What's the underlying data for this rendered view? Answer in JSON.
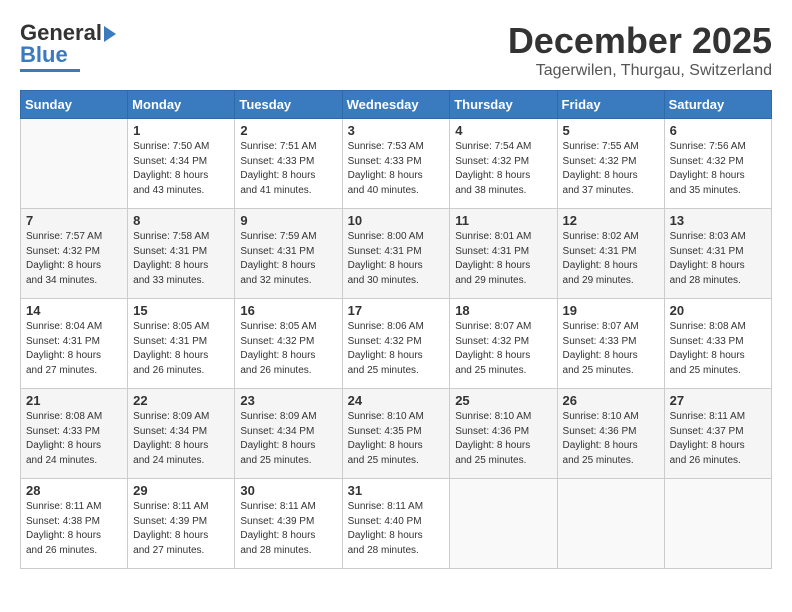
{
  "header": {
    "logo_general": "General",
    "logo_blue": "Blue",
    "month": "December 2025",
    "location": "Tagerwilen, Thurgau, Switzerland"
  },
  "weekdays": [
    "Sunday",
    "Monday",
    "Tuesday",
    "Wednesday",
    "Thursday",
    "Friday",
    "Saturday"
  ],
  "weeks": [
    [
      {
        "day": "",
        "sunrise": "",
        "sunset": "",
        "daylight": ""
      },
      {
        "day": "1",
        "sunrise": "Sunrise: 7:50 AM",
        "sunset": "Sunset: 4:34 PM",
        "daylight": "Daylight: 8 hours and 43 minutes."
      },
      {
        "day": "2",
        "sunrise": "Sunrise: 7:51 AM",
        "sunset": "Sunset: 4:33 PM",
        "daylight": "Daylight: 8 hours and 41 minutes."
      },
      {
        "day": "3",
        "sunrise": "Sunrise: 7:53 AM",
        "sunset": "Sunset: 4:33 PM",
        "daylight": "Daylight: 8 hours and 40 minutes."
      },
      {
        "day": "4",
        "sunrise": "Sunrise: 7:54 AM",
        "sunset": "Sunset: 4:32 PM",
        "daylight": "Daylight: 8 hours and 38 minutes."
      },
      {
        "day": "5",
        "sunrise": "Sunrise: 7:55 AM",
        "sunset": "Sunset: 4:32 PM",
        "daylight": "Daylight: 8 hours and 37 minutes."
      },
      {
        "day": "6",
        "sunrise": "Sunrise: 7:56 AM",
        "sunset": "Sunset: 4:32 PM",
        "daylight": "Daylight: 8 hours and 35 minutes."
      }
    ],
    [
      {
        "day": "7",
        "sunrise": "Sunrise: 7:57 AM",
        "sunset": "Sunset: 4:32 PM",
        "daylight": "Daylight: 8 hours and 34 minutes."
      },
      {
        "day": "8",
        "sunrise": "Sunrise: 7:58 AM",
        "sunset": "Sunset: 4:31 PM",
        "daylight": "Daylight: 8 hours and 33 minutes."
      },
      {
        "day": "9",
        "sunrise": "Sunrise: 7:59 AM",
        "sunset": "Sunset: 4:31 PM",
        "daylight": "Daylight: 8 hours and 32 minutes."
      },
      {
        "day": "10",
        "sunrise": "Sunrise: 8:00 AM",
        "sunset": "Sunset: 4:31 PM",
        "daylight": "Daylight: 8 hours and 30 minutes."
      },
      {
        "day": "11",
        "sunrise": "Sunrise: 8:01 AM",
        "sunset": "Sunset: 4:31 PM",
        "daylight": "Daylight: 8 hours and 29 minutes."
      },
      {
        "day": "12",
        "sunrise": "Sunrise: 8:02 AM",
        "sunset": "Sunset: 4:31 PM",
        "daylight": "Daylight: 8 hours and 29 minutes."
      },
      {
        "day": "13",
        "sunrise": "Sunrise: 8:03 AM",
        "sunset": "Sunset: 4:31 PM",
        "daylight": "Daylight: 8 hours and 28 minutes."
      }
    ],
    [
      {
        "day": "14",
        "sunrise": "Sunrise: 8:04 AM",
        "sunset": "Sunset: 4:31 PM",
        "daylight": "Daylight: 8 hours and 27 minutes."
      },
      {
        "day": "15",
        "sunrise": "Sunrise: 8:05 AM",
        "sunset": "Sunset: 4:31 PM",
        "daylight": "Daylight: 8 hours and 26 minutes."
      },
      {
        "day": "16",
        "sunrise": "Sunrise: 8:05 AM",
        "sunset": "Sunset: 4:32 PM",
        "daylight": "Daylight: 8 hours and 26 minutes."
      },
      {
        "day": "17",
        "sunrise": "Sunrise: 8:06 AM",
        "sunset": "Sunset: 4:32 PM",
        "daylight": "Daylight: 8 hours and 25 minutes."
      },
      {
        "day": "18",
        "sunrise": "Sunrise: 8:07 AM",
        "sunset": "Sunset: 4:32 PM",
        "daylight": "Daylight: 8 hours and 25 minutes."
      },
      {
        "day": "19",
        "sunrise": "Sunrise: 8:07 AM",
        "sunset": "Sunset: 4:33 PM",
        "daylight": "Daylight: 8 hours and 25 minutes."
      },
      {
        "day": "20",
        "sunrise": "Sunrise: 8:08 AM",
        "sunset": "Sunset: 4:33 PM",
        "daylight": "Daylight: 8 hours and 25 minutes."
      }
    ],
    [
      {
        "day": "21",
        "sunrise": "Sunrise: 8:08 AM",
        "sunset": "Sunset: 4:33 PM",
        "daylight": "Daylight: 8 hours and 24 minutes."
      },
      {
        "day": "22",
        "sunrise": "Sunrise: 8:09 AM",
        "sunset": "Sunset: 4:34 PM",
        "daylight": "Daylight: 8 hours and 24 minutes."
      },
      {
        "day": "23",
        "sunrise": "Sunrise: 8:09 AM",
        "sunset": "Sunset: 4:34 PM",
        "daylight": "Daylight: 8 hours and 25 minutes."
      },
      {
        "day": "24",
        "sunrise": "Sunrise: 8:10 AM",
        "sunset": "Sunset: 4:35 PM",
        "daylight": "Daylight: 8 hours and 25 minutes."
      },
      {
        "day": "25",
        "sunrise": "Sunrise: 8:10 AM",
        "sunset": "Sunset: 4:36 PM",
        "daylight": "Daylight: 8 hours and 25 minutes."
      },
      {
        "day": "26",
        "sunrise": "Sunrise: 8:10 AM",
        "sunset": "Sunset: 4:36 PM",
        "daylight": "Daylight: 8 hours and 25 minutes."
      },
      {
        "day": "27",
        "sunrise": "Sunrise: 8:11 AM",
        "sunset": "Sunset: 4:37 PM",
        "daylight": "Daylight: 8 hours and 26 minutes."
      }
    ],
    [
      {
        "day": "28",
        "sunrise": "Sunrise: 8:11 AM",
        "sunset": "Sunset: 4:38 PM",
        "daylight": "Daylight: 8 hours and 26 minutes."
      },
      {
        "day": "29",
        "sunrise": "Sunrise: 8:11 AM",
        "sunset": "Sunset: 4:39 PM",
        "daylight": "Daylight: 8 hours and 27 minutes."
      },
      {
        "day": "30",
        "sunrise": "Sunrise: 8:11 AM",
        "sunset": "Sunset: 4:39 PM",
        "daylight": "Daylight: 8 hours and 28 minutes."
      },
      {
        "day": "31",
        "sunrise": "Sunrise: 8:11 AM",
        "sunset": "Sunset: 4:40 PM",
        "daylight": "Daylight: 8 hours and 28 minutes."
      },
      {
        "day": "",
        "sunrise": "",
        "sunset": "",
        "daylight": ""
      },
      {
        "day": "",
        "sunrise": "",
        "sunset": "",
        "daylight": ""
      },
      {
        "day": "",
        "sunrise": "",
        "sunset": "",
        "daylight": ""
      }
    ]
  ]
}
